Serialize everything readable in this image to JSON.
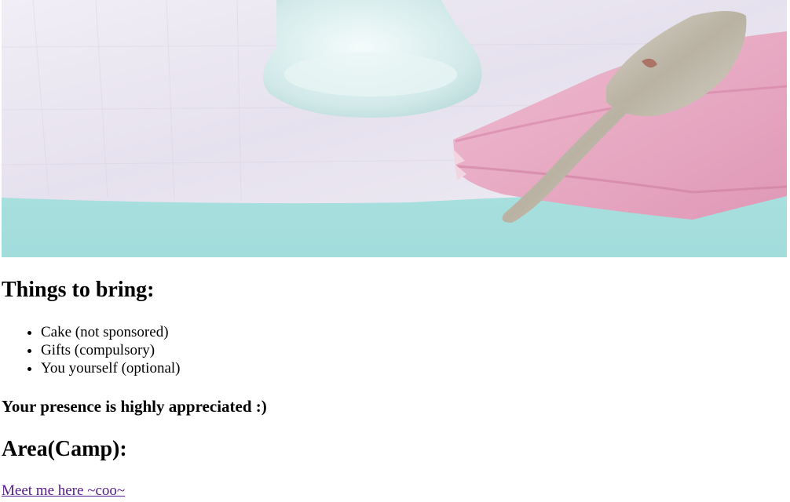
{
  "hero": {
    "description_icon": "cake-server-on-napkin-image",
    "colors": {
      "tablecloth": "#ece9f3",
      "napkin": "#e9a9c3",
      "table": "#aee3e2",
      "stand": "#d8ecec",
      "server": "#c8c2b4"
    }
  },
  "bring": {
    "heading": "Things to bring:",
    "items": [
      "Cake (not sponsored)",
      "Gifts (compulsory)",
      "You yourself (optional)"
    ]
  },
  "presence": {
    "text": "Your presence is highly appreciated :)"
  },
  "area": {
    "heading": "Area(Camp):",
    "link_text": "Meet me here ~coo~",
    "link_color": "#551a8b"
  }
}
